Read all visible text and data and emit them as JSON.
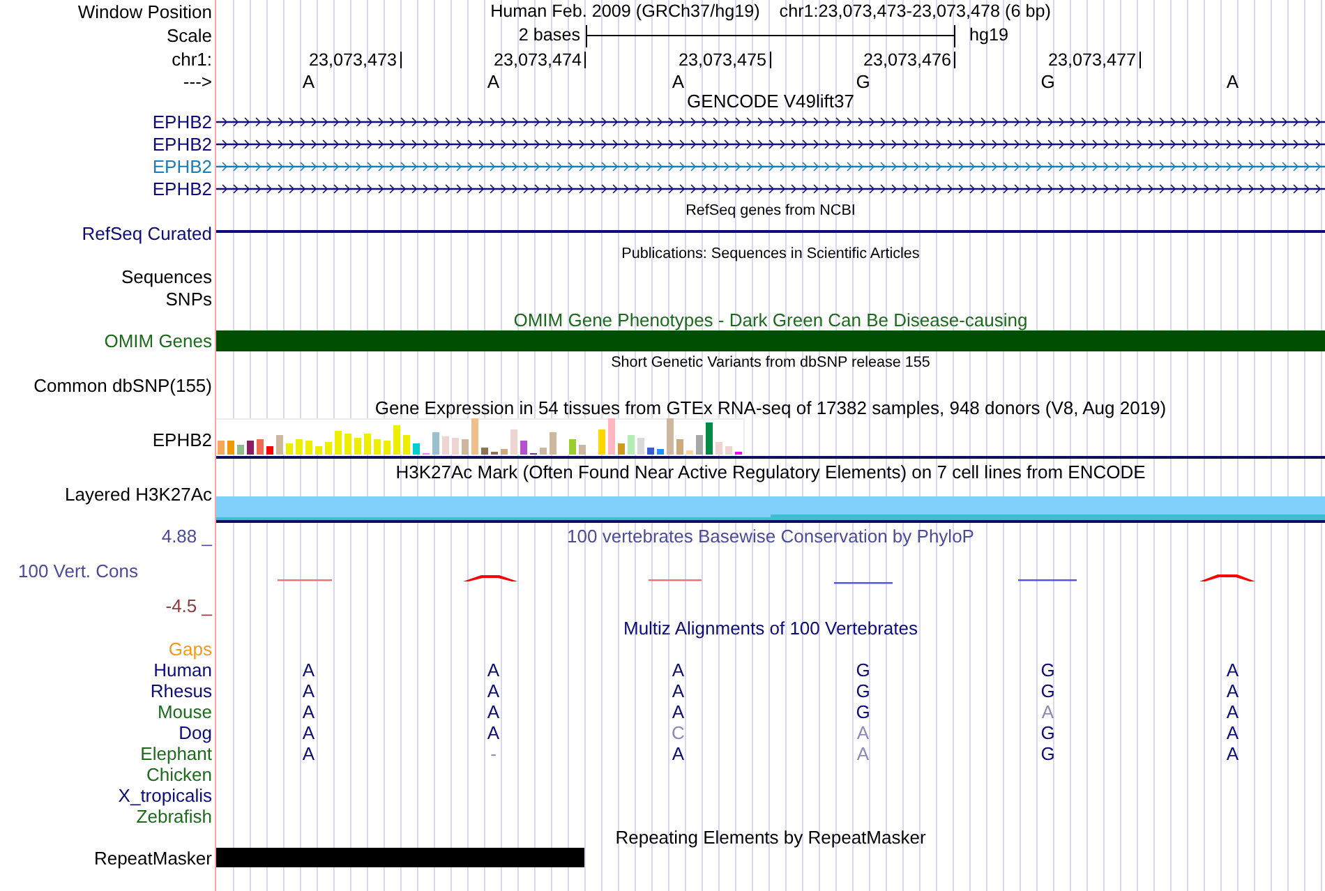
{
  "header": {
    "position_label": "Window Position",
    "assembly": "Human Feb. 2009 (GRCh37/hg19)",
    "position": "chr1:23,073,473-23,073,478 (6 bp)",
    "scale_label": "Scale",
    "scale_span": "2 bases",
    "scale_assembly": "hg19",
    "chrom_label": "chr1:",
    "ruler": [
      "23,073,473",
      "23,073,474",
      "23,073,475",
      "23,073,476",
      "23,073,477"
    ],
    "strand_label": "--->",
    "bases": [
      "A",
      "A",
      "A",
      "G",
      "G",
      "A"
    ]
  },
  "tracks": [
    {
      "kind": "transcripts",
      "title": "GENCODE V49lift37",
      "items": [
        {
          "label": "EPHB2",
          "color": "#0c0c78"
        },
        {
          "label": "EPHB2",
          "color": "#0c0c78"
        },
        {
          "label": "EPHB2",
          "color": "#1f7ab8"
        },
        {
          "label": "EPHB2",
          "color": "#0c0c78"
        }
      ]
    },
    {
      "kind": "line",
      "title": "RefSeq genes from NCBI",
      "label": "RefSeq Curated"
    },
    {
      "kind": "empty",
      "title": "Publications: Sequences in Scientific Articles",
      "labels": [
        "Sequences",
        "SNPs"
      ]
    },
    {
      "kind": "omim",
      "title": "OMIM Gene Phenotypes - Dark Green Can Be Disease-causing",
      "label": "OMIM Genes"
    },
    {
      "kind": "empty",
      "title": "Short Genetic Variants from dbSNP release 155",
      "labels": [
        "Common dbSNP(155)"
      ]
    },
    {
      "kind": "expression",
      "title": "Gene Expression in 54 tissues from GTEx RNA-seq of 17382 samples, 948 donors (V8, Aug 2019)",
      "label": "EPHB2"
    },
    {
      "kind": "layered",
      "title": "H3K27Ac Mark (Often Found Near Active Regulatory Elements) on 7 cell lines from ENCODE",
      "label": "Layered H3K27Ac"
    },
    {
      "kind": "wiggle",
      "title": "100 vertebrates Basewise Conservation by PhyloP",
      "label": "100 Vert. Cons",
      "axis_max": "4.88 _",
      "axis_min": "-4.5 _"
    },
    {
      "kind": "alignment",
      "title": "Multiz Alignments of 100 Vertebrates",
      "gaps_label": "Gaps",
      "species": [
        {
          "name": "Human",
          "color": "#0c0c78",
          "bases": [
            {
              "base": "A",
              "mismatch": false
            },
            {
              "base": "A",
              "mismatch": false
            },
            {
              "base": "A",
              "mismatch": false
            },
            {
              "base": "G",
              "mismatch": false
            },
            {
              "base": "G",
              "mismatch": false
            },
            {
              "base": "A",
              "mismatch": false
            }
          ]
        },
        {
          "name": "Rhesus",
          "color": "#0c0c78",
          "bases": [
            {
              "base": "A",
              "mismatch": false
            },
            {
              "base": "A",
              "mismatch": false
            },
            {
              "base": "A",
              "mismatch": false
            },
            {
              "base": "G",
              "mismatch": false
            },
            {
              "base": "G",
              "mismatch": false
            },
            {
              "base": "A",
              "mismatch": false
            }
          ]
        },
        {
          "name": "Mouse",
          "color": "#1c6b1c",
          "bases": [
            {
              "base": "A",
              "mismatch": false
            },
            {
              "base": "A",
              "mismatch": false
            },
            {
              "base": "A",
              "mismatch": false
            },
            {
              "base": "G",
              "mismatch": false
            },
            {
              "base": "A",
              "mismatch": true
            },
            {
              "base": "A",
              "mismatch": false
            }
          ]
        },
        {
          "name": "Dog",
          "color": "#0c0c78",
          "bases": [
            {
              "base": "A",
              "mismatch": false
            },
            {
              "base": "A",
              "mismatch": false
            },
            {
              "base": "C",
              "mismatch": true
            },
            {
              "base": "A",
              "mismatch": true
            },
            {
              "base": "G",
              "mismatch": false
            },
            {
              "base": "A",
              "mismatch": false
            }
          ]
        },
        {
          "name": "Elephant",
          "color": "#1c6b1c",
          "bases": [
            {
              "base": "A",
              "mismatch": false
            },
            {
              "base": "-",
              "mismatch": true
            },
            {
              "base": "A",
              "mismatch": false
            },
            {
              "base": "A",
              "mismatch": true
            },
            {
              "base": "G",
              "mismatch": false
            },
            {
              "base": "A",
              "mismatch": false
            }
          ]
        },
        {
          "name": "Chicken",
          "color": "#1c6b1c"
        },
        {
          "name": "X_tropicalis",
          "color": "#0c0c78"
        },
        {
          "name": "Zebrafish",
          "color": "#1c6b1c"
        }
      ]
    },
    {
      "kind": "repeats",
      "title": "Repeating Elements by RepeatMasker",
      "label": "RepeatMasker"
    }
  ]
}
